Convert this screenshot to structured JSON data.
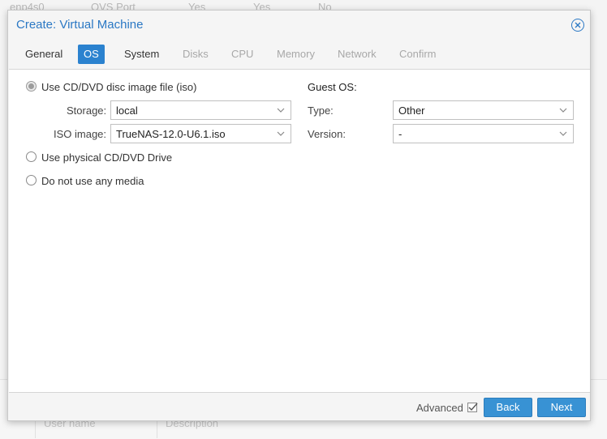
{
  "background": {
    "top_row": [
      "enp4s0",
      "OVS Port",
      "Yes",
      "Yes",
      "No"
    ],
    "bottom_row": [
      "User name",
      "Description"
    ]
  },
  "dialog": {
    "title": "Create: Virtual Machine",
    "close_icon": "close-circle-icon",
    "tabs": [
      {
        "label": "General",
        "state": "normal"
      },
      {
        "label": "OS",
        "state": "active"
      },
      {
        "label": "System",
        "state": "normal"
      },
      {
        "label": "Disks",
        "state": "disabled"
      },
      {
        "label": "CPU",
        "state": "disabled"
      },
      {
        "label": "Memory",
        "state": "disabled"
      },
      {
        "label": "Network",
        "state": "disabled"
      },
      {
        "label": "Confirm",
        "state": "disabled"
      }
    ],
    "media": {
      "option_iso": "Use CD/DVD disc image file (iso)",
      "storage_label": "Storage:",
      "storage_value": "local",
      "iso_label": "ISO image:",
      "iso_value": "TrueNAS-12.0-U6.1.iso",
      "option_physical": "Use physical CD/DVD Drive",
      "option_none": "Do not use any media",
      "selected": "iso"
    },
    "guest_os": {
      "title": "Guest OS:",
      "type_label": "Type:",
      "type_value": "Other",
      "version_label": "Version:",
      "version_value": "-"
    },
    "footer": {
      "advanced_label": "Advanced",
      "advanced_checked": true,
      "back_label": "Back",
      "next_label": "Next"
    }
  },
  "colors": {
    "accent": "#2b82cf",
    "title": "#2b78c4",
    "button": "#3892d4"
  }
}
